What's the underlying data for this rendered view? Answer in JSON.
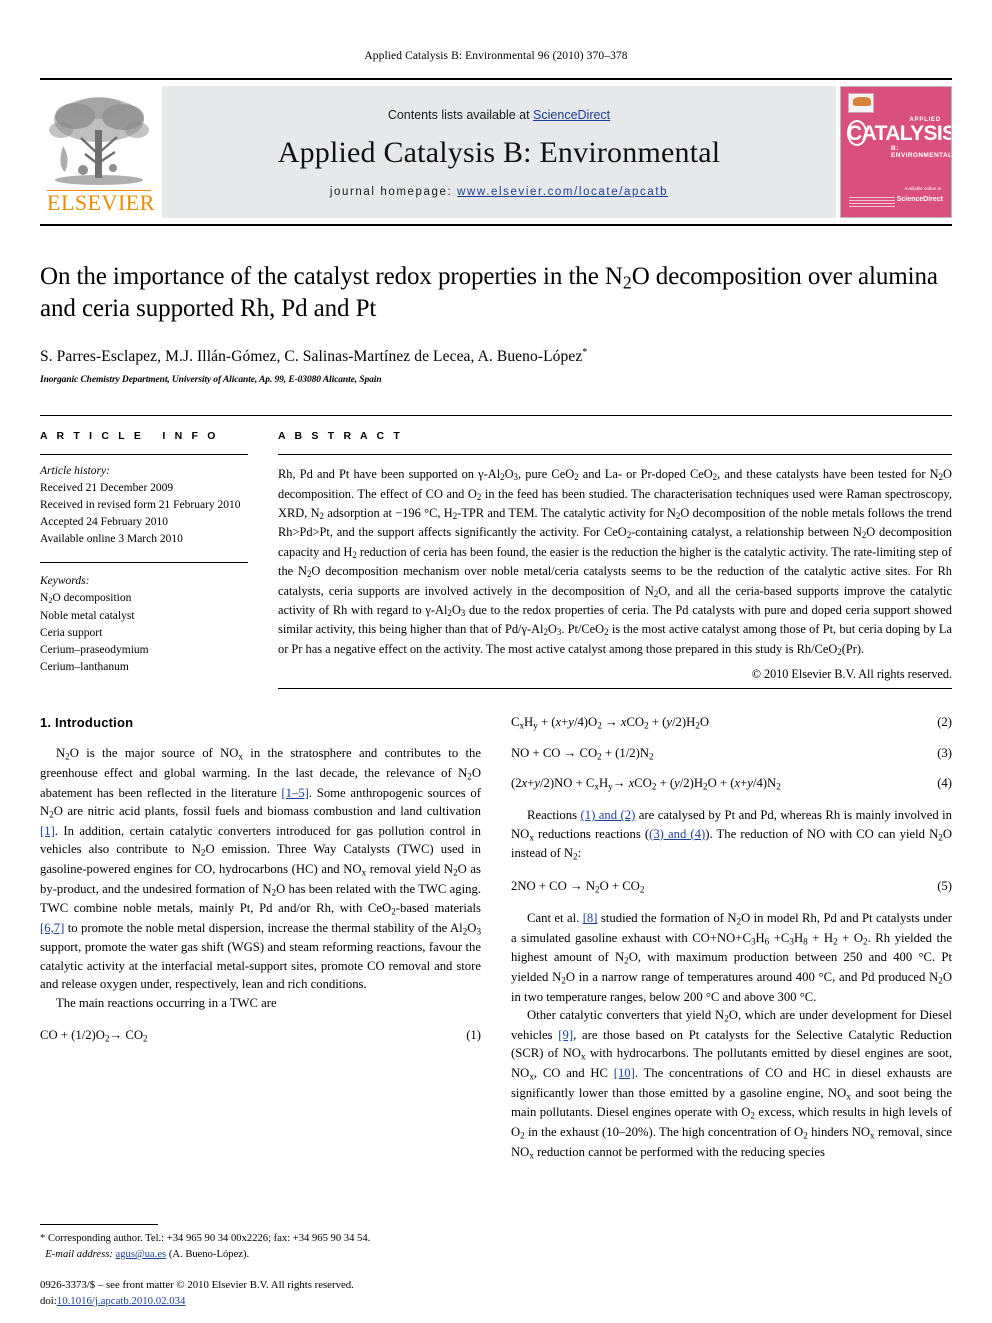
{
  "running_head": "Applied Catalysis B: Environmental 96 (2010) 370–378",
  "masthead": {
    "publisher_name": "ELSEVIER",
    "contents_prefix": "Contents lists available at ",
    "contents_link": "ScienceDirect",
    "journal_title": "Applied Catalysis B: Environmental",
    "homepage_label": "journal homepage:",
    "homepage_url": "www.elsevier.com/locate/apcatb",
    "cover": {
      "applied": "APPLIED",
      "main": "CATALYSIS",
      "sub": "B: ENVIRONMENTAL",
      "foot": "Available online at",
      "sciencedirect": "ScienceDirect"
    },
    "accent_orange": "#ED8B00",
    "link_blue": "#1c3f94",
    "band_gray": "#e7e8ea",
    "cover_pink": "#d94f7e"
  },
  "title": "On the importance of the catalyst redox properties in the N₂O decomposition over alumina and ceria supported Rh, Pd and Pt",
  "authors": "S. Parres-Esclapez, M.J. Illán-Gómez, C. Salinas-Martínez de Lecea, A. Bueno-López",
  "affiliation": "Inorganic Chemistry Department, University of Alicante, Ap. 99, E-03080 Alicante, Spain",
  "article_info": {
    "heading": "ARTICLE INFO",
    "history_label": "Article history:",
    "history": [
      "Received 21 December 2009",
      "Received in revised form 21 February 2010",
      "Accepted 24 February 2010",
      "Available online 3 March 2010"
    ],
    "keywords_label": "Keywords:",
    "keywords": [
      "N₂O decomposition",
      "Noble metal catalyst",
      "Ceria support",
      "Cerium–praseodymium",
      "Cerium–lanthanum"
    ]
  },
  "abstract": {
    "heading": "ABSTRACT",
    "copyright": "© 2010 Elsevier B.V. All rights reserved."
  },
  "intro": {
    "heading": "1. Introduction"
  },
  "equations": {
    "eq1_num": "(1)",
    "eq2_num": "(2)",
    "eq3_num": "(3)",
    "eq4_num": "(4)",
    "eq5_num": "(5)"
  },
  "footnote": {
    "corresponding": "* Corresponding author. Tel.: +34 965 90 34 00x2226; fax: +34 965 90 34 54.",
    "email_label": "E-mail address:",
    "email": "agus@ua.es",
    "email_person": "(A. Bueno-López)."
  },
  "footer": {
    "issn_line": "0926-3373/$ – see front matter © 2010 Elsevier B.V. All rights reserved.",
    "doi_label": "doi:",
    "doi": "10.1016/j.apcatb.2010.02.034"
  }
}
